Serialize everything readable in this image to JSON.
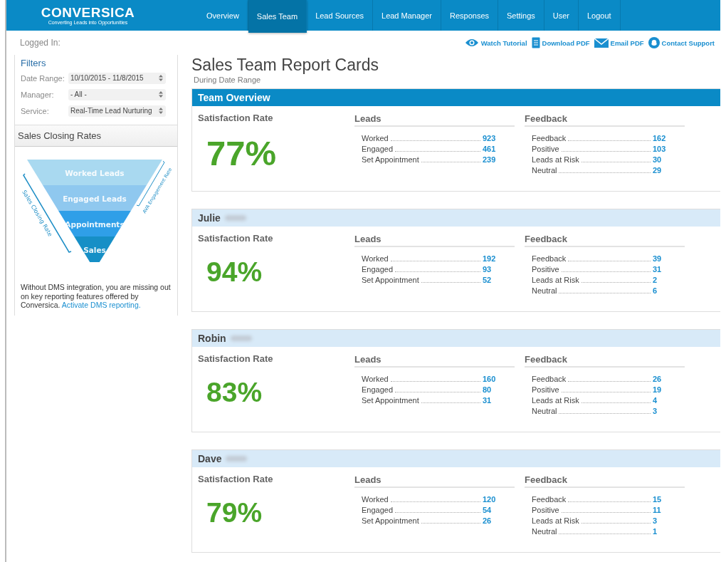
{
  "logo": {
    "name": "CONVERSICA",
    "tagline": "Converting Leads into Opportunities"
  },
  "nav": [
    {
      "label": "Overview",
      "selected": false
    },
    {
      "label": "Sales Team",
      "selected": true
    },
    {
      "label": "Lead Sources",
      "selected": false
    },
    {
      "label": "Lead Manager",
      "selected": false
    },
    {
      "label": "Responses",
      "selected": false
    },
    {
      "label": "Settings",
      "selected": false
    },
    {
      "label": "User",
      "selected": false
    },
    {
      "label": "Logout",
      "selected": false
    }
  ],
  "logged_in": "Logged In:",
  "actions": [
    {
      "kind": "eye",
      "label": "Watch Tutorial"
    },
    {
      "kind": "doc",
      "label": "Download PDF"
    },
    {
      "kind": "mail",
      "label": "Email PDF"
    },
    {
      "kind": "support",
      "label": "Contact Support"
    }
  ],
  "filters": {
    "title": "Filters",
    "fields": [
      {
        "label": "Date Range:",
        "value": "10/10/2015 - 11/8/2015"
      },
      {
        "label": "Manager:",
        "value": "- All -"
      },
      {
        "label": "Service:",
        "value": "Real-Time Lead Nurturing"
      }
    ]
  },
  "closing_rates": {
    "title": "Sales Closing Rates",
    "funnel": [
      "Worked Leads",
      "Engaged Leads",
      "Appointments",
      "Sales"
    ],
    "left_label": "Sales Closing Rate",
    "right_label": "AVA Engagement Rate",
    "note": "Without DMS integration, you are missing out on key reporting features offered by Conversica.",
    "link": "Activate DMS reporting."
  },
  "title": "Sales Team Report Cards",
  "subtitle": "During Date Range",
  "cards": [
    {
      "kind": "team",
      "name": "Team Overview",
      "redacted": false,
      "rate_label": "Satisfaction Rate",
      "rate": "77%",
      "leads_title": "Leads",
      "leads": [
        {
          "label": "Worked",
          "value": "923"
        },
        {
          "label": "Engaged",
          "value": "461"
        },
        {
          "label": "Set Appointment",
          "value": "239"
        }
      ],
      "feedback_title": "Feedback",
      "feedback": [
        {
          "label": "Feedback",
          "value": "162"
        },
        {
          "label": "Positive",
          "value": "103"
        },
        {
          "label": "Leads at Risk",
          "value": "30"
        },
        {
          "label": "Neutral",
          "value": "29"
        }
      ]
    },
    {
      "kind": "person",
      "name": "Julie",
      "redacted": true,
      "rate_label": "Satisfaction Rate",
      "rate": "94%",
      "leads_title": "Leads",
      "leads": [
        {
          "label": "Worked",
          "value": "192"
        },
        {
          "label": "Engaged",
          "value": "93"
        },
        {
          "label": "Set Appointment",
          "value": "52"
        }
      ],
      "feedback_title": "Feedback",
      "feedback": [
        {
          "label": "Feedback",
          "value": "39"
        },
        {
          "label": "Positive",
          "value": "31"
        },
        {
          "label": "Leads at Risk",
          "value": "2"
        },
        {
          "label": "Neutral",
          "value": "6"
        }
      ]
    },
    {
      "kind": "person",
      "name": "Robin",
      "redacted": true,
      "rate_label": "Satisfaction Rate",
      "rate": "83%",
      "leads_title": "Leads",
      "leads": [
        {
          "label": "Worked",
          "value": "160"
        },
        {
          "label": "Engaged",
          "value": "80"
        },
        {
          "label": "Set Appointment",
          "value": "31"
        }
      ],
      "feedback_title": "Feedback",
      "feedback": [
        {
          "label": "Feedback",
          "value": "26"
        },
        {
          "label": "Positive",
          "value": "19"
        },
        {
          "label": "Leads at Risk",
          "value": "4"
        },
        {
          "label": "Neutral",
          "value": "3"
        }
      ]
    },
    {
      "kind": "person",
      "name": "Dave",
      "redacted": true,
      "rate_label": "Satisfaction Rate",
      "rate": "79%",
      "leads_title": "Leads",
      "leads": [
        {
          "label": "Worked",
          "value": "120"
        },
        {
          "label": "Engaged",
          "value": "54"
        },
        {
          "label": "Set Appointment",
          "value": "26"
        }
      ],
      "feedback_title": "Feedback",
      "feedback": [
        {
          "label": "Feedback",
          "value": "15"
        },
        {
          "label": "Positive",
          "value": "11"
        },
        {
          "label": "Leads at Risk",
          "value": "3"
        },
        {
          "label": "Neutral",
          "value": "1"
        }
      ]
    }
  ]
}
